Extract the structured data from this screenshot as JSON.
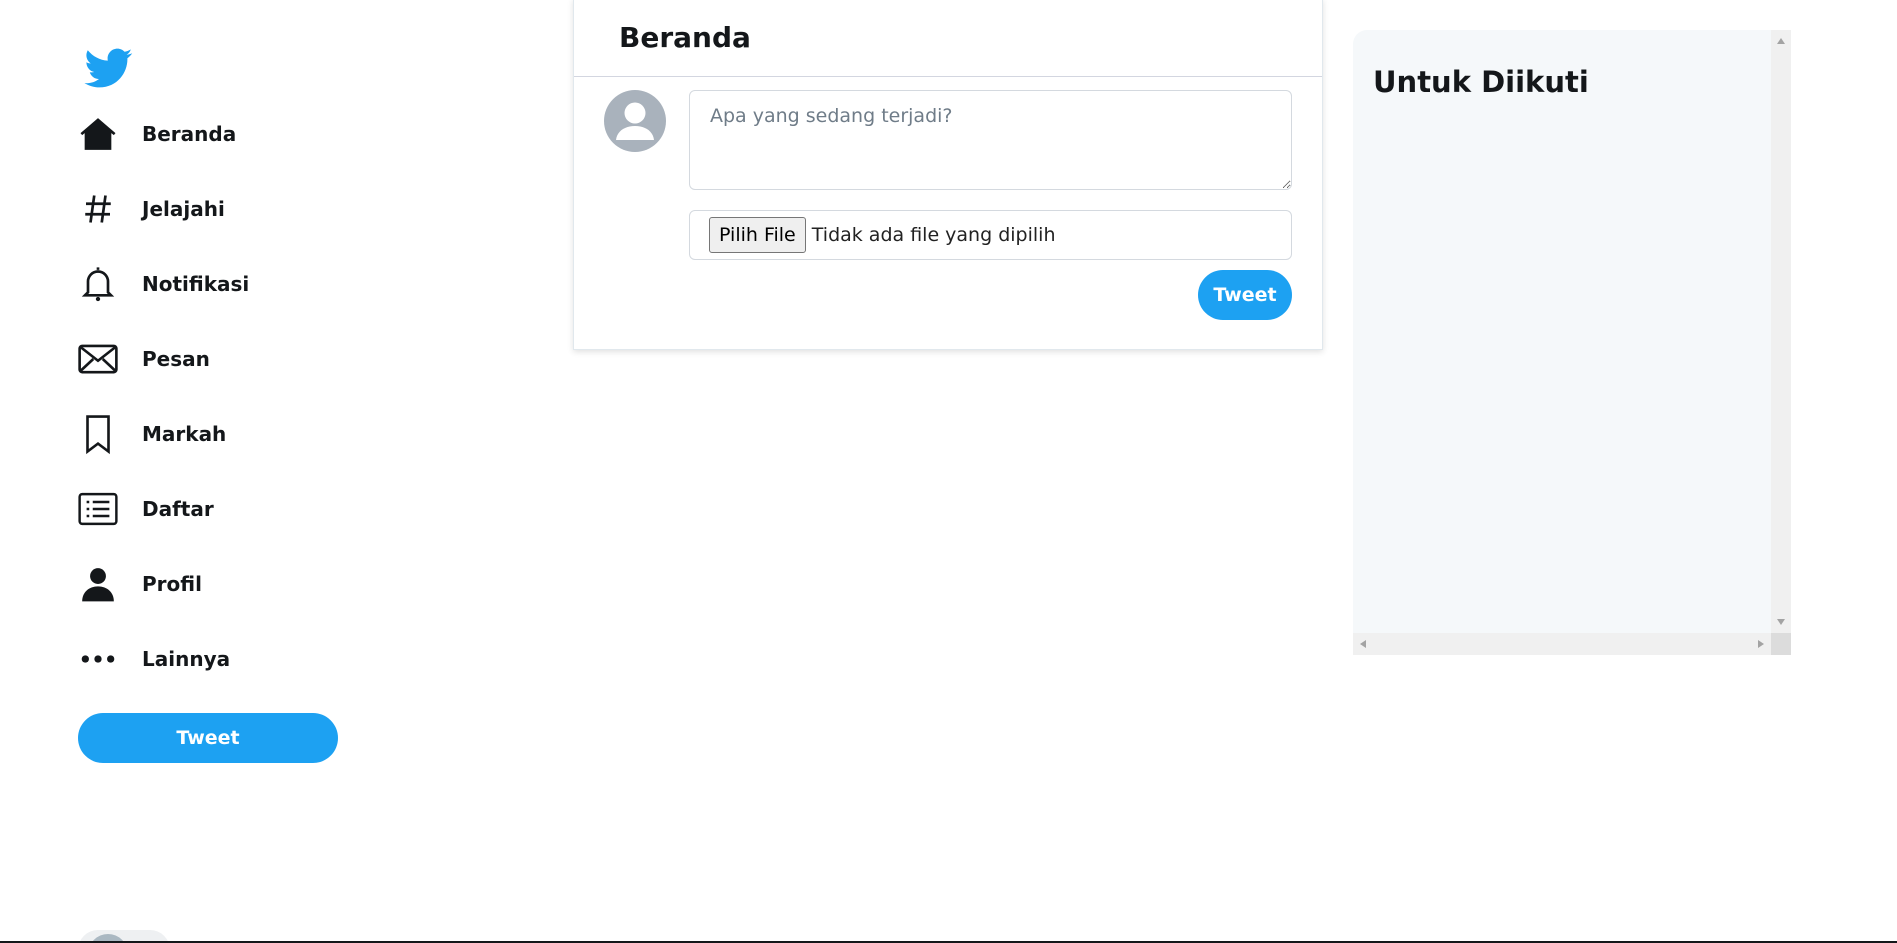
{
  "colors": {
    "accent": "#1da1f2",
    "text": "#14171a",
    "panel_bg": "#f5f8fa"
  },
  "sidebar": {
    "logo_icon": "twitter-bird-icon",
    "items": [
      {
        "label": "Beranda",
        "icon": "home-icon"
      },
      {
        "label": "Jelajahi",
        "icon": "hashtag-icon"
      },
      {
        "label": "Notifikasi",
        "icon": "bell-icon"
      },
      {
        "label": "Pesan",
        "icon": "envelope-icon"
      },
      {
        "label": "Markah",
        "icon": "bookmark-icon"
      },
      {
        "label": "Daftar",
        "icon": "list-icon"
      },
      {
        "label": "Profil",
        "icon": "person-icon"
      },
      {
        "label": "Lainnya",
        "icon": "more-dots-icon"
      }
    ],
    "tweet_label": "Tweet"
  },
  "feed": {
    "title": "Beranda",
    "compose": {
      "placeholder": "Apa yang sedang terjadi?",
      "file_button": "Pilih File",
      "file_status": "Tidak ada file yang dipilih",
      "tweet_label": "Tweet"
    }
  },
  "right_panel": {
    "title": "Untuk Diikuti"
  }
}
